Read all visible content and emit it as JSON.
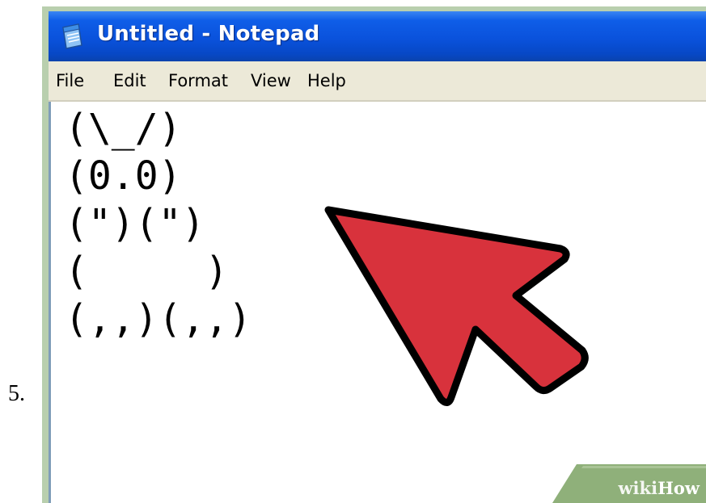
{
  "step": {
    "number": "5."
  },
  "window": {
    "title": "Untitled - Notepad",
    "icon": "notepad-icon"
  },
  "menu": {
    "file": "File",
    "edit": "Edit",
    "format": "Format",
    "view": "View",
    "help": "Help"
  },
  "document": {
    "lines": [
      "(\\_/)",
      "(0.0)",
      "(\")(\")",
      "(     )",
      "(,,)(,,)"
    ]
  },
  "overlay": {
    "arrow_icon": "pointer-arrow-icon",
    "arrow_color": "#d8323c"
  },
  "watermark": {
    "part1": "wiki",
    "part2": "How",
    "color": "#8fb07a"
  },
  "colors": {
    "titlebar": "#0a52dc",
    "menubar": "#ece9d8",
    "frame": "#b9cfae"
  }
}
